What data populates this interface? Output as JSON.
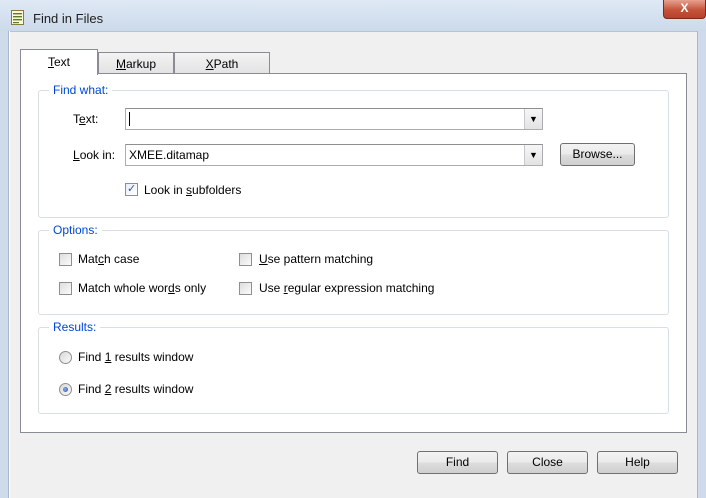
{
  "window": {
    "title": "Find in Files",
    "close_glyph": "X"
  },
  "tabs": [
    {
      "pre": "",
      "key": "T",
      "post": "ext",
      "active": true
    },
    {
      "pre": "",
      "key": "M",
      "post": "arkup",
      "active": false
    },
    {
      "pre": "",
      "key": "X",
      "post": "Path",
      "active": false
    }
  ],
  "find_what": {
    "group_title": "Find what:",
    "text_label": {
      "pre": "T",
      "key": "e",
      "post": "xt:"
    },
    "text_value": "",
    "look_in_label": {
      "pre": "",
      "key": "L",
      "post": "ook in:"
    },
    "look_in_value": "XMEE.ditamap",
    "browse_label": "Browse...",
    "subfolders": {
      "pre": "Look in ",
      "key": "s",
      "post": "ubfolders",
      "checked": true
    }
  },
  "options": {
    "group_title": "Options:",
    "match_case": {
      "pre": "Mat",
      "key": "c",
      "post": "h case",
      "checked": false
    },
    "whole_words": {
      "pre": "Match whole wor",
      "key": "d",
      "post": "s only",
      "checked": false
    },
    "pattern": {
      "pre": "",
      "key": "U",
      "post": "se pattern matching",
      "checked": false
    },
    "regex": {
      "pre": "Use ",
      "key": "r",
      "post": "egular expression matching",
      "checked": false
    }
  },
  "results": {
    "group_title": "Results:",
    "window1": {
      "pre": "Find ",
      "key": "1",
      "post": " results window",
      "selected": false
    },
    "window2": {
      "pre": "Find ",
      "key": "2",
      "post": " results window",
      "selected": true
    }
  },
  "buttons": {
    "find": "Find",
    "close": "Close",
    "help": "Help"
  },
  "icons": {
    "window": "find-in-files-icon",
    "dropdown": "chevron-down-icon",
    "check": "checkmark-icon"
  }
}
